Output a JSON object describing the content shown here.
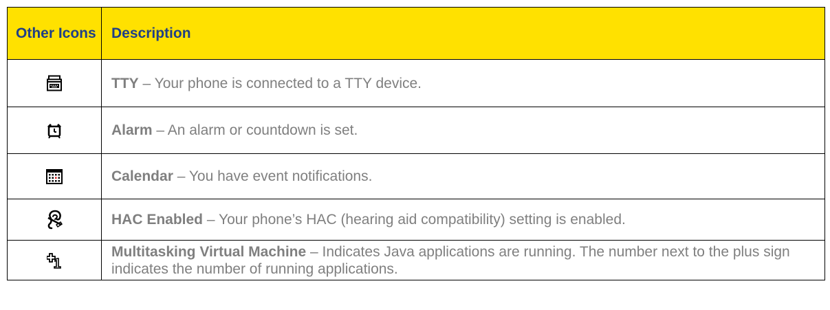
{
  "table": {
    "header": {
      "icon_col": "Other Icons",
      "desc_col": "Description"
    },
    "rows": [
      {
        "icon": "tty-icon",
        "term": "TTY",
        "text": " – Your phone is connected to a TTY device."
      },
      {
        "icon": "alarm-clock-icon",
        "term": "Alarm",
        "text": " – An alarm or countdown is set."
      },
      {
        "icon": "calendar-icon",
        "term": "Calendar",
        "text": " – You have event notifications."
      },
      {
        "icon": "hearing-aid-icon",
        "term": "HAC Enabled",
        "text": " – Your phone’s HAC (hearing aid compatibility) setting is enabled."
      },
      {
        "icon": "multitasking-vm-icon",
        "term": "Multitasking Virtual Machine",
        "text": " – Indicates Java applications are running. The number next to the plus sign indicates the number of running applications."
      }
    ]
  },
  "colors": {
    "header_bg": "#FFE100",
    "header_text": "#1f3f87",
    "body_text": "#7f7f7f",
    "calendar_accent": "#e02020"
  }
}
